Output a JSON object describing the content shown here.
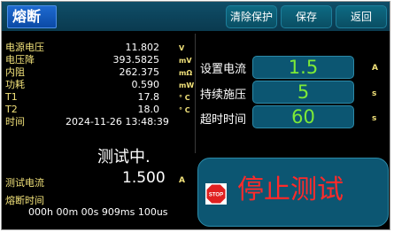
{
  "header": {
    "title": "熔断",
    "buttons": {
      "clear": "清除保护",
      "save": "保存",
      "back": "返回"
    }
  },
  "readings": [
    {
      "label": "电源电压",
      "value": "11.802",
      "unit": "V"
    },
    {
      "label": "电压降",
      "value": "393.5825",
      "unit": "mV"
    },
    {
      "label": "内阻",
      "value": "262.375",
      "unit": "mΩ"
    },
    {
      "label": "功耗",
      "value": "0.590",
      "unit": "mW"
    },
    {
      "label": "T1",
      "value": "17.8",
      "unit": "° C"
    },
    {
      "label": "T2",
      "value": "18.0",
      "unit": "° C"
    }
  ],
  "time": {
    "label": "时间",
    "value": "2024-11-26 13:48:39"
  },
  "status": "测试中.",
  "test_current": {
    "label": "测试电流",
    "value": "1.500",
    "unit": "A"
  },
  "fuse_time": {
    "label": "熔断时间",
    "value": "000h 00m 00s 909ms 100us"
  },
  "settings": [
    {
      "label": "设置电流",
      "value": "1.5",
      "unit": "A"
    },
    {
      "label": "持续施压",
      "value": "5",
      "unit": "s"
    },
    {
      "label": "超时时间",
      "value": "60",
      "unit": "s"
    }
  ],
  "stop": {
    "icon_text": "STOP",
    "label": "停止测试"
  },
  "colors": {
    "label": "#f2e27a",
    "value": "#ffffff",
    "setting_value": "#7dea37",
    "stop_text": "#ff2a2a",
    "panel_teal": "#0c5672"
  }
}
